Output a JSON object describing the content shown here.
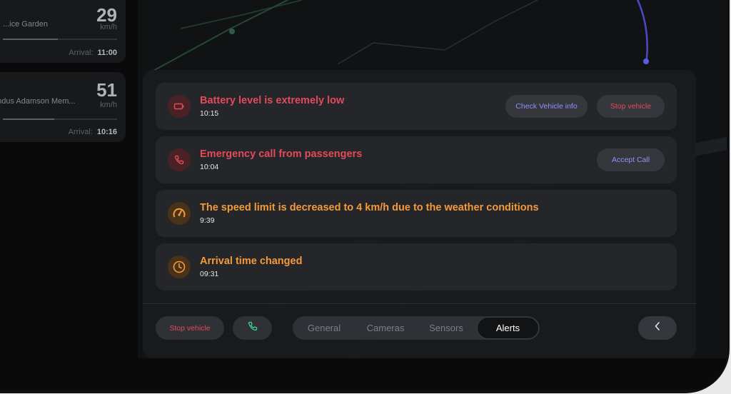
{
  "trips": [
    {
      "speed": "29",
      "unit": "km/h",
      "name": "...ice Garden",
      "arrival_label": "Arrival:",
      "arrival_time": "11:00"
    },
    {
      "speed": "51",
      "unit": "km/h",
      "name": "andus Adamson Mem...",
      "arrival_label": "Arrival:",
      "arrival_time": "10:16"
    }
  ],
  "alerts": [
    {
      "title": "Battery level is extremely low",
      "time": "10:15",
      "icon": "battery-icon",
      "buttons": [
        "Check Vehicle info",
        "Stop vehicle"
      ]
    },
    {
      "title": "Emergency call from passengers",
      "time": "10:04",
      "icon": "phone-icon",
      "buttons": [
        "Accept Call"
      ]
    },
    {
      "title": "The speed limit is decreased to 4 km/h due to the weather conditions",
      "time": "9:39",
      "icon": "speedometer-icon"
    },
    {
      "title": "Arrival time changed",
      "time": "09:31",
      "icon": "clock-icon"
    }
  ],
  "bottom": {
    "stop_label": "Stop vehicle",
    "phone_icon": "phone-icon",
    "tabs": [
      "General",
      "Cameras",
      "Sensors",
      "Alerts"
    ],
    "active_tab": "Alerts",
    "back_icon": "chevron-left-icon"
  },
  "colors": {
    "red": "#e24b59",
    "orange": "#f49a3b",
    "blue": "#8c93ff",
    "green": "#3ecf8e"
  }
}
